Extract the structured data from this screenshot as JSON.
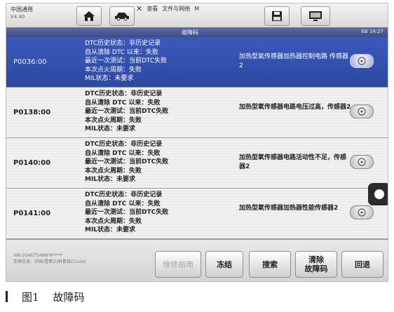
{
  "app": {
    "name": "中国通用",
    "version": "V4.40"
  },
  "overlay_toolbar": {
    "items": [
      "查看",
      "文件与网络",
      "M"
    ]
  },
  "header": {
    "title": "故障码",
    "status": "EB 14:27"
  },
  "rows": [
    {
      "code": "P0036:00",
      "status_lines": [
        "DTC历史状态：非历史记录",
        "自从清除 DTC 以来：失败",
        "最近一次测试：当前DTC失败",
        "本次点火周期：失败",
        "MIL状态：未要求"
      ],
      "description": "加热型氧传感器加热器控制电路 传感器2",
      "selected": true
    },
    {
      "code": "P0138:00",
      "status_lines": [
        "DTC历史状态：非历史记录",
        "自从清除 DTC 以来：失败",
        "最近一次测试：当前DTC失败",
        "本次点火周期：失败",
        "MIL状态：未要求"
      ],
      "description": "加热型氧传感器电路电压过高，传感器2",
      "selected": false
    },
    {
      "code": "P0140:00",
      "status_lines": [
        "DTC历史状态：非历史记录",
        "自从清除 DTC 以来：失败",
        "最近一次测试：当前DTC失败",
        "本次点火周期：失败",
        "MIL状态：未要求"
      ],
      "description": "加热型氧传感器电路活动性不足，传感器2",
      "selected": false
    },
    {
      "code": "P0141:00",
      "status_lines": [
        "DTC历史状态：非历史记录",
        "自从清除 DTC 以来：失败",
        "最近一次测试：当前DTC失败",
        "本次点火周期：失败",
        "MIL状态：未要求"
      ],
      "description": "加热型氧传感器加热器性能传感器2",
      "selected": false
    }
  ],
  "footer": {
    "vin": "VIN:2G4GT5488F9*****",
    "vehicle": "车辆信息：中国/雪佛兰/科鲁兹(Cruze)",
    "buttons": {
      "guide": "维修指南",
      "freeze": "冻结",
      "search": "搜索",
      "clear": "清除\n故障码",
      "back": "回退"
    }
  },
  "caption": {
    "label": "图1",
    "text": "故障码"
  },
  "colors": {
    "selected_row": "#2f4ea8",
    "header_bar": "#46558f"
  }
}
